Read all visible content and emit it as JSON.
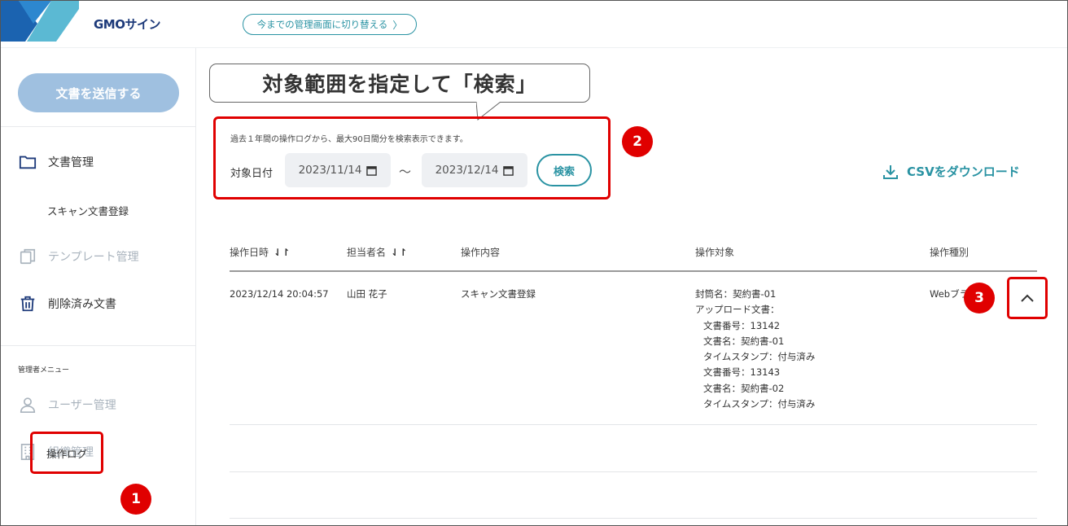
{
  "header": {
    "brand": "GMOサイン",
    "switch_button": "今までの管理画面に切り替える",
    "switch_chevron": "〉"
  },
  "sidebar": {
    "send_button": "文書を送信する",
    "doc_management": "文書管理",
    "scan_registration": "スキャン文書登録",
    "template_management": "テンプレート管理",
    "deleted_docs": "削除済み文書",
    "admin_menu_label": "管理者メニュー",
    "user_management": "ユーザー管理",
    "org_management": "組織管理",
    "operation_log": "操作ログ"
  },
  "callout": {
    "text": "対象範囲を指定して「検索」"
  },
  "search": {
    "note": "過去１年間の操作ログから、最大90日間分を検索表示できます。",
    "date_label": "対象日付",
    "from_date": "2023/11/14",
    "tilde": "〜",
    "to_date": "2023/12/14",
    "button": "検索"
  },
  "csv_download": "CSVをダウンロード",
  "badges": {
    "one": "1",
    "two": "2",
    "three": "3"
  },
  "table": {
    "headers": {
      "datetime": "操作日時",
      "user": "担当者名",
      "content": "操作内容",
      "target": "操作対象",
      "type": "操作種別"
    },
    "sort_glyph": "⇃↾",
    "row": {
      "datetime": "2023/12/14 20:04:57",
      "user": "山田 花子",
      "content": "スキャン文書登録",
      "target_lines": [
        "封筒名：契約書-01",
        "アップロード文書：",
        "文書番号：13142",
        "文書名：契約書-01",
        "タイムスタンプ：付与済み",
        "文書番号：13143",
        "文書名：契約書-02",
        "タイムスタンプ：付与済み"
      ],
      "type": "Webブラ"
    }
  },
  "colors": {
    "accent": "#2a93a3",
    "annotation_red": "#e00000",
    "send_button": "#9fc0e0",
    "brand_navy": "#1d3a7a"
  },
  "icons": {
    "folder": "folder-icon",
    "template": "template-icon",
    "trash": "trash-icon",
    "user": "user-icon",
    "building": "building-icon",
    "calendar": "calendar-icon",
    "download": "download-icon",
    "chevron_up": "chevron-up-icon"
  }
}
